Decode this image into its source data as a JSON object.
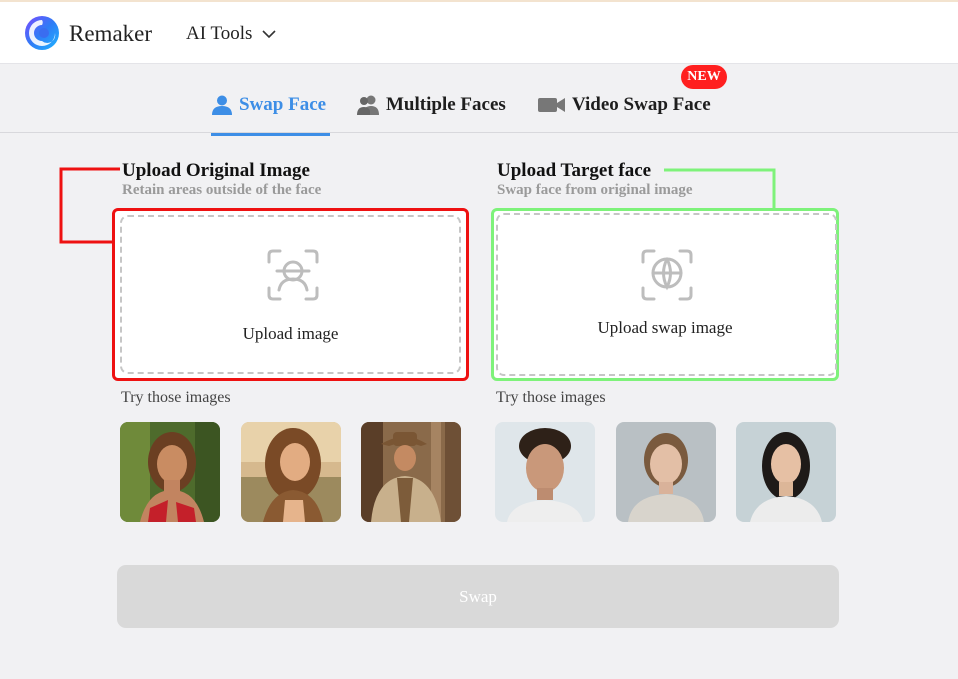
{
  "header": {
    "brand": "Remaker",
    "menu_label": "AI Tools"
  },
  "tabs": [
    {
      "label": "Swap Face",
      "active": true
    },
    {
      "label": "Multiple Faces",
      "active": false
    },
    {
      "label": "Video Swap Face",
      "active": false,
      "badge": "NEW"
    }
  ],
  "original": {
    "title": "Upload Original Image",
    "subtitle": "Retain areas outside of the face",
    "upload_label": "Upload image",
    "try_label": "Try those images",
    "samples": [
      "sample-woman-tropical",
      "sample-woman-sunset",
      "sample-cowboy"
    ]
  },
  "target": {
    "title": "Upload Target face",
    "subtitle": "Swap face from original image",
    "upload_label": "Upload swap image",
    "try_label": "Try those images",
    "samples": [
      "sample-man-curly",
      "sample-woman-sweater",
      "sample-woman-portrait"
    ]
  },
  "swap_button": "Swap",
  "colors": {
    "accent": "#3d8ee6",
    "badge": "#ff1f1f",
    "annotation_red": "#ee1111",
    "annotation_green": "#7ef27a",
    "swap_disabled": "#d9d9d9"
  }
}
